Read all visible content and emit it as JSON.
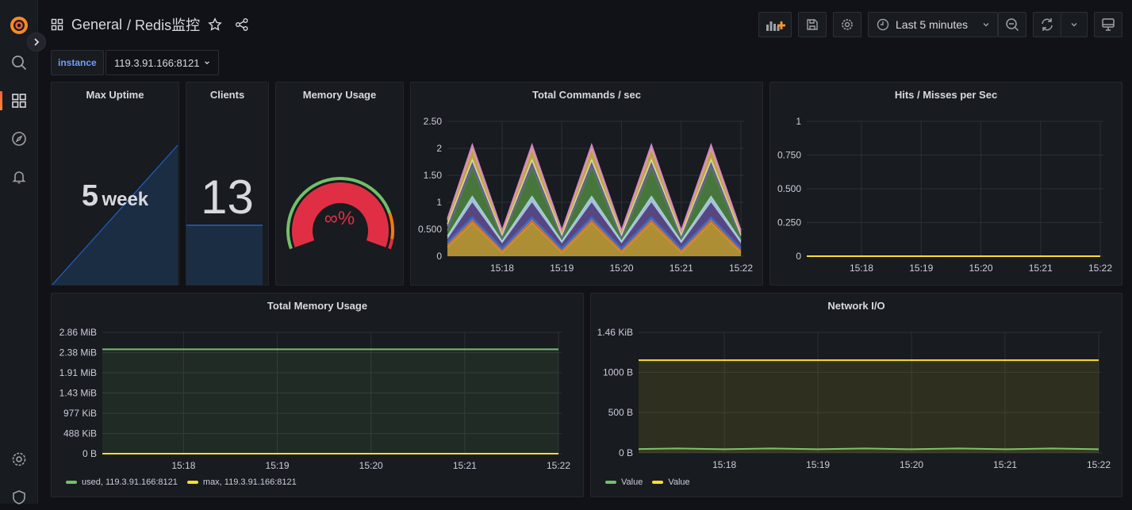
{
  "sidebar": {
    "items": [
      {
        "icon": "grafana-logo-icon"
      },
      {
        "icon": "search-icon"
      },
      {
        "icon": "dashboards-icon",
        "active": true
      },
      {
        "icon": "explore-compass-icon"
      },
      {
        "icon": "alerting-bell-icon"
      },
      {
        "icon": "settings-gear-icon"
      },
      {
        "icon": "admin-shield-icon"
      }
    ]
  },
  "header": {
    "folder": "General",
    "title": "/ Redis监控",
    "time_range": "Last 5 minutes"
  },
  "variables": {
    "label": "instance",
    "value": "119.3.91.166:8121"
  },
  "colors": {
    "accent": "#f55f3e",
    "green": "#73bf69",
    "yellow": "#fade2a",
    "stat_blue": "#1f60c4",
    "gauge_red": "#e02f44"
  },
  "panels": {
    "uptime": {
      "title": "Max Uptime",
      "value": "5",
      "unit": "week"
    },
    "clients": {
      "title": "Clients",
      "value": "13",
      "spark_level": 0.33
    },
    "memory_usage": {
      "title": "Memory Usage",
      "value": "∞",
      "unit": "%",
      "gauge_fill": 1.0
    }
  },
  "chart_data": [
    {
      "id": "commands",
      "type": "area",
      "stacked": true,
      "title": "Total Commands / sec",
      "ylim": [
        0,
        2.5
      ],
      "yticks": [
        {
          "v": 0,
          "l": "0"
        },
        {
          "v": 0.5,
          "l": "0.500"
        },
        {
          "v": 1,
          "l": "1"
        },
        {
          "v": 1.5,
          "l": "1.50"
        },
        {
          "v": 2,
          "l": "2"
        },
        {
          "v": 2.5,
          "l": "2.50"
        }
      ],
      "xlim": [
        "15:17:05",
        "15:22:00"
      ],
      "xticks": [
        "15:18",
        "15:19",
        "15:20",
        "15:21",
        "15:22"
      ],
      "grid": true,
      "x": [
        "15:17:05",
        "15:17:30",
        "15:18:00",
        "15:18:30",
        "15:19:00",
        "15:19:30",
        "15:20:00",
        "15:20:30",
        "15:21:00",
        "15:21:30",
        "15:22:00"
      ],
      "series": [
        {
          "color": "#c8a23a",
          "values": [
            0.17,
            0.62,
            0.07,
            0.62,
            0.07,
            0.62,
            0.07,
            0.62,
            0.07,
            0.62,
            0.07
          ]
        },
        {
          "color": "#e0752d",
          "values": [
            0.05,
            0.06,
            0.04,
            0.06,
            0.04,
            0.06,
            0.04,
            0.06,
            0.04,
            0.06,
            0.04
          ]
        },
        {
          "color": "#3274d9",
          "values": [
            0.05,
            0.05,
            0.05,
            0.05,
            0.05,
            0.05,
            0.05,
            0.05,
            0.05,
            0.05,
            0.05
          ]
        },
        {
          "color": "#614d93",
          "values": [
            0.05,
            0.27,
            0.08,
            0.27,
            0.08,
            0.27,
            0.08,
            0.27,
            0.08,
            0.27,
            0.08
          ]
        },
        {
          "color": "#badff4",
          "values": [
            0.06,
            0.12,
            0.05,
            0.12,
            0.05,
            0.12,
            0.05,
            0.12,
            0.05,
            0.12,
            0.05
          ]
        },
        {
          "color": "#508642",
          "values": [
            0.1,
            0.53,
            0.03,
            0.53,
            0.03,
            0.53,
            0.03,
            0.53,
            0.03,
            0.53,
            0.03
          ]
        },
        {
          "color": "#705da0",
          "values": [
            0.08,
            0.1,
            0.05,
            0.1,
            0.05,
            0.1,
            0.05,
            0.1,
            0.05,
            0.1,
            0.05
          ]
        },
        {
          "color": "#cfe6a8",
          "values": [
            0.04,
            0.05,
            0.03,
            0.05,
            0.03,
            0.05,
            0.03,
            0.05,
            0.03,
            0.05,
            0.03
          ]
        },
        {
          "color": "#d8b857",
          "values": [
            0.07,
            0.2,
            0.04,
            0.2,
            0.04,
            0.2,
            0.04,
            0.2,
            0.04,
            0.2,
            0.04
          ]
        },
        {
          "color": "#d683ce",
          "values": [
            0.03,
            0.07,
            0.04,
            0.07,
            0.04,
            0.07,
            0.04,
            0.07,
            0.04,
            0.07,
            0.04
          ]
        }
      ]
    },
    {
      "id": "hits",
      "type": "line",
      "title": "Hits / Misses per Sec",
      "ylim": [
        0,
        1
      ],
      "yticks": [
        {
          "v": 0,
          "l": "0"
        },
        {
          "v": 0.25,
          "l": "0.250"
        },
        {
          "v": 0.5,
          "l": "0.500"
        },
        {
          "v": 0.75,
          "l": "0.750"
        },
        {
          "v": 1,
          "l": "1"
        }
      ],
      "xlim": [
        "15:17:05",
        "15:22:00"
      ],
      "xticks": [
        "15:18",
        "15:19",
        "15:20",
        "15:21",
        "15:22"
      ],
      "grid": true,
      "x": [
        "15:17:05",
        "15:22:00"
      ],
      "series": [
        {
          "color": "#fade2a",
          "values": [
            0,
            0
          ]
        }
      ]
    },
    {
      "id": "totalmem",
      "type": "line",
      "fill": true,
      "title": "Total Memory Usage",
      "ylim": [
        0,
        2.86
      ],
      "yticks": [
        {
          "v": 0,
          "l": "0 B"
        },
        {
          "v": 0.4766,
          "l": "488 KiB"
        },
        {
          "v": 0.954,
          "l": "977 KiB"
        },
        {
          "v": 1.43,
          "l": "1.43 MiB"
        },
        {
          "v": 1.91,
          "l": "1.91 MiB"
        },
        {
          "v": 2.38,
          "l": "2.38 MiB"
        },
        {
          "v": 2.86,
          "l": "2.86 MiB"
        }
      ],
      "xlim": [
        "15:17:08",
        "15:22:00"
      ],
      "xticks": [
        "15:18",
        "15:19",
        "15:20",
        "15:21",
        "15:22"
      ],
      "grid": true,
      "legend": "bottom-left",
      "x": [
        "15:17:08",
        "15:22:00"
      ],
      "series": [
        {
          "name": "used, 119.3.91.166:8121",
          "color": "#73bf69",
          "values": [
            2.46,
            2.46
          ]
        },
        {
          "name": "max, 119.3.91.166:8121",
          "color": "#fade2a",
          "values": [
            0,
            0
          ]
        }
      ]
    },
    {
      "id": "network",
      "type": "line",
      "fill": true,
      "title": "Network I/O",
      "ylim": [
        0,
        1495
      ],
      "yticks": [
        {
          "v": 0,
          "l": "0 B"
        },
        {
          "v": 500,
          "l": "500 B"
        },
        {
          "v": 1000,
          "l": "1000 B"
        },
        {
          "v": 1495,
          "l": "1.46 KiB"
        }
      ],
      "xlim": [
        "15:17:05",
        "15:22:00"
      ],
      "xticks": [
        "15:18",
        "15:19",
        "15:20",
        "15:21",
        "15:22"
      ],
      "grid": true,
      "legend": "bottom-left",
      "x": [
        "15:17:05",
        "15:17:30",
        "15:18:00",
        "15:18:30",
        "15:19:00",
        "15:19:30",
        "15:20:00",
        "15:20:30",
        "15:21:00",
        "15:21:30",
        "15:22:00"
      ],
      "series": [
        {
          "name": "Value",
          "color": "#73bf69",
          "values": [
            48,
            55,
            45,
            55,
            45,
            55,
            45,
            55,
            45,
            55,
            45
          ]
        },
        {
          "name": "Value",
          "color": "#fade2a",
          "values": [
            1150,
            1150,
            1149,
            1150,
            1149,
            1150,
            1149,
            1150,
            1149,
            1150,
            1149
          ]
        }
      ]
    }
  ]
}
